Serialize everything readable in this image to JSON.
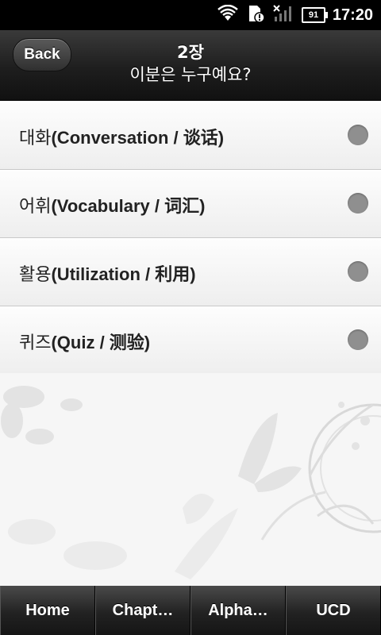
{
  "status_bar": {
    "time": "17:20",
    "battery": "91",
    "icons": [
      "wifi-icon",
      "sd-card-alert-icon",
      "signal-off-icon",
      "battery-icon"
    ]
  },
  "header": {
    "back_label": "Back",
    "title_line1": "2장",
    "title_line2": "이분은 누구예요?"
  },
  "menu": {
    "items": [
      {
        "korean": "대화",
        "detail": "(Conversation / 谈话)"
      },
      {
        "korean": "어휘",
        "detail": "(Vocabulary / 词汇)"
      },
      {
        "korean": "활용",
        "detail": "(Utilization / 利用)"
      },
      {
        "korean": "퀴즈",
        "detail": "(Quiz / 测验)"
      }
    ]
  },
  "tabs": [
    {
      "label": "Home"
    },
    {
      "label": "Chapt…"
    },
    {
      "label": "Alpha…"
    },
    {
      "label": "UCD"
    }
  ],
  "colors": {
    "header_bg": "#1e1e1e",
    "list_bg": "#f5f5f5",
    "indicator": "#8f8f8f",
    "tabbar_bg": "#222222"
  }
}
